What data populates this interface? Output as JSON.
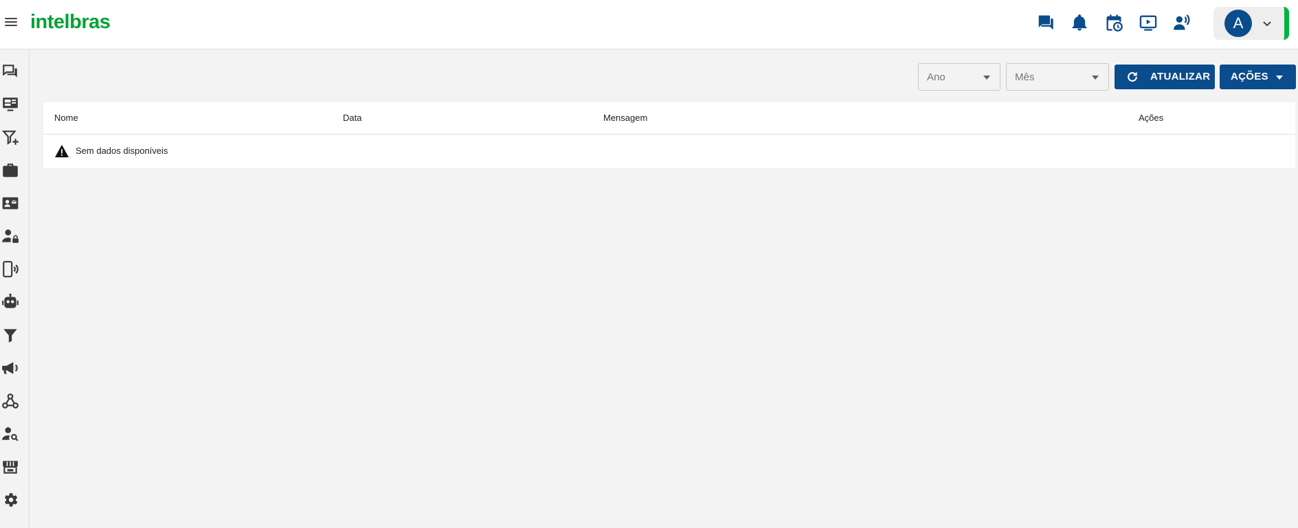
{
  "brand": {
    "logo_text": "intelbras",
    "logo_color": "#00a335",
    "accent": "#0b4c8c",
    "status_bar_color": "#00b33c"
  },
  "header": {
    "menu_icon": "hamburger-menu-icon",
    "icons": [
      "chat-icon",
      "notifications-bell-icon",
      "schedule-calendar-icon",
      "video-play-icon",
      "voice-broadcast-icon"
    ],
    "user": {
      "avatar_letter": "A",
      "dropdown_icon": "chevron-down-icon"
    }
  },
  "sidebar": {
    "items": [
      "conversations-icon",
      "dashboard-monitor-icon",
      "add-filter-icon",
      "briefcase-icon",
      "contact-card-icon",
      "user-lock-icon",
      "mobile-signal-icon",
      "robot-icon",
      "filter-icon",
      "megaphone-icon",
      "webhook-icon",
      "user-search-icon",
      "store-icon",
      "settings-gear-icon"
    ]
  },
  "toolbar": {
    "year_placeholder": "Ano",
    "month_placeholder": "Mês",
    "refresh_label": "ATUALIZAR",
    "actions_label": "AÇÕES"
  },
  "table": {
    "columns": [
      "Nome",
      "Data",
      "Mensagem",
      "Ações"
    ],
    "empty_message": "Sem dados disponíveis"
  }
}
